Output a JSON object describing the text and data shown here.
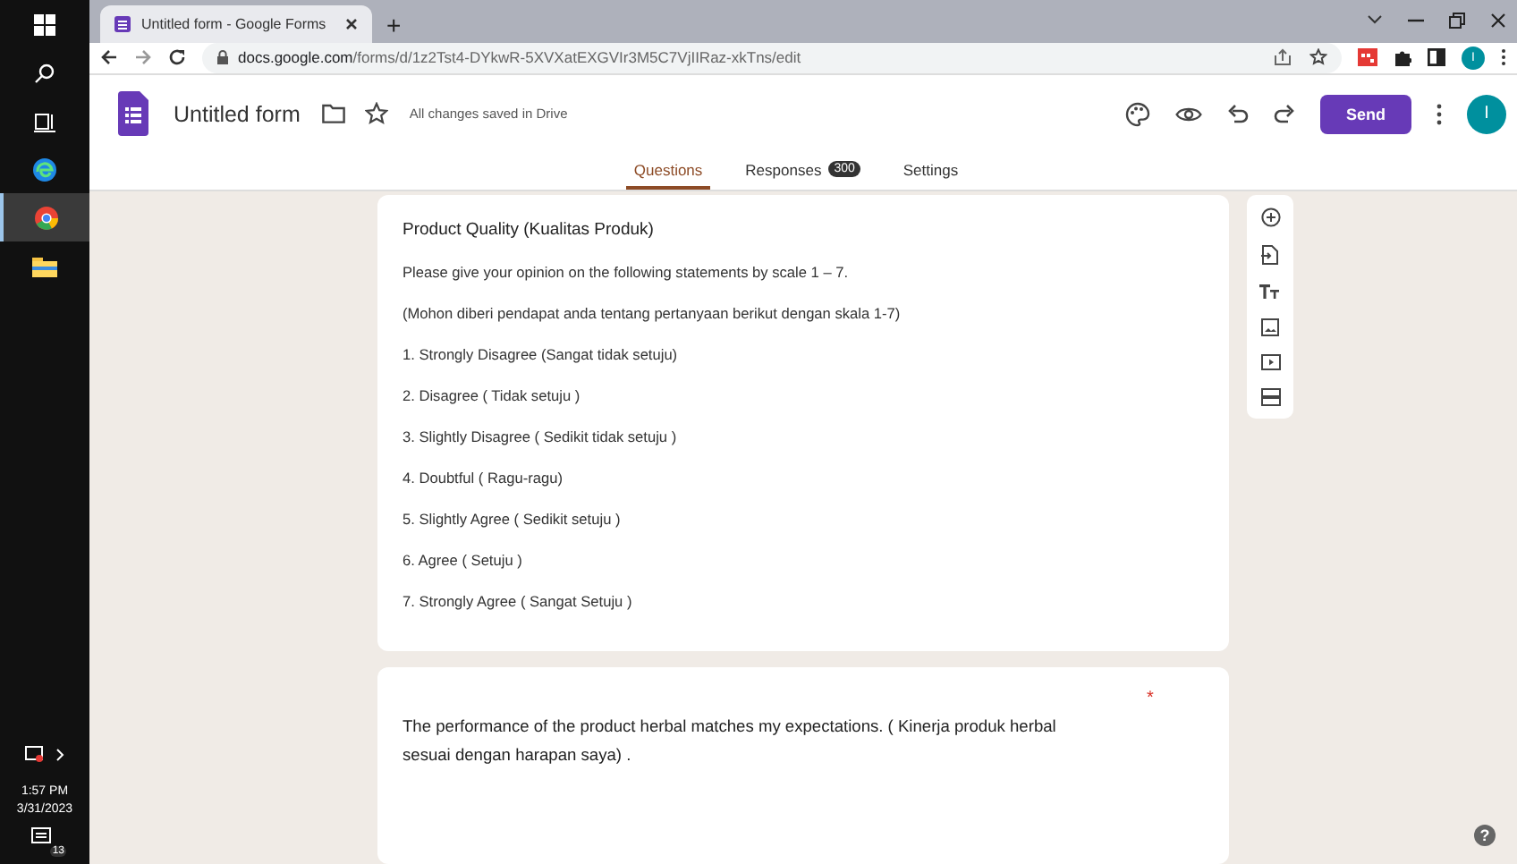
{
  "taskbar": {
    "time": "1:57 PM",
    "date": "3/31/2023",
    "notification_count": "13"
  },
  "browser": {
    "tab_title": "Untitled form - Google Forms",
    "new_tab": "+",
    "url_host": "docs.google.com",
    "url_path": "/forms/d/1z2Tst4-DYkwR-5XVXatEXGVIr3M5C7VjIIRaz-xkTns/edit",
    "profile_initial": "I"
  },
  "form_header": {
    "title": "Untitled form",
    "save_status": "All changes saved in Drive",
    "send_label": "Send",
    "avatar_initial": "I"
  },
  "tabs": [
    {
      "label": "Questions",
      "selected": true
    },
    {
      "label": "Responses",
      "badge": "300",
      "selected": false
    },
    {
      "label": "Settings",
      "selected": false
    }
  ],
  "cards": [
    {
      "kind": "text",
      "title": "Product Quality (Kualitas Produk)",
      "lines": [
        "Please give your opinion on the following statements by scale 1 – 7.",
        "(Mohon diberi pendapat anda tentang pertanyaan berikut dengan skala 1-7)",
        "1. Strongly Disagree (Sangat tidak setuju)",
        "2. Disagree ( Tidak setuju )",
        "3. Slightly Disagree ( Sedikit tidak setuju )",
        "4. Doubtful ( Ragu-ragu)",
        "5. Slightly Agree ( Sedikit setuju )",
        "6. Agree ( Setuju )",
        "7. Strongly Agree ( Sangat Setuju )"
      ]
    },
    {
      "kind": "question",
      "text": "The performance of the product herbal matches my expectations. ( Kinerja produk herbal sesuai dengan harapan saya) .",
      "required": true,
      "required_mark": "*"
    }
  ],
  "help_glyph": "?"
}
